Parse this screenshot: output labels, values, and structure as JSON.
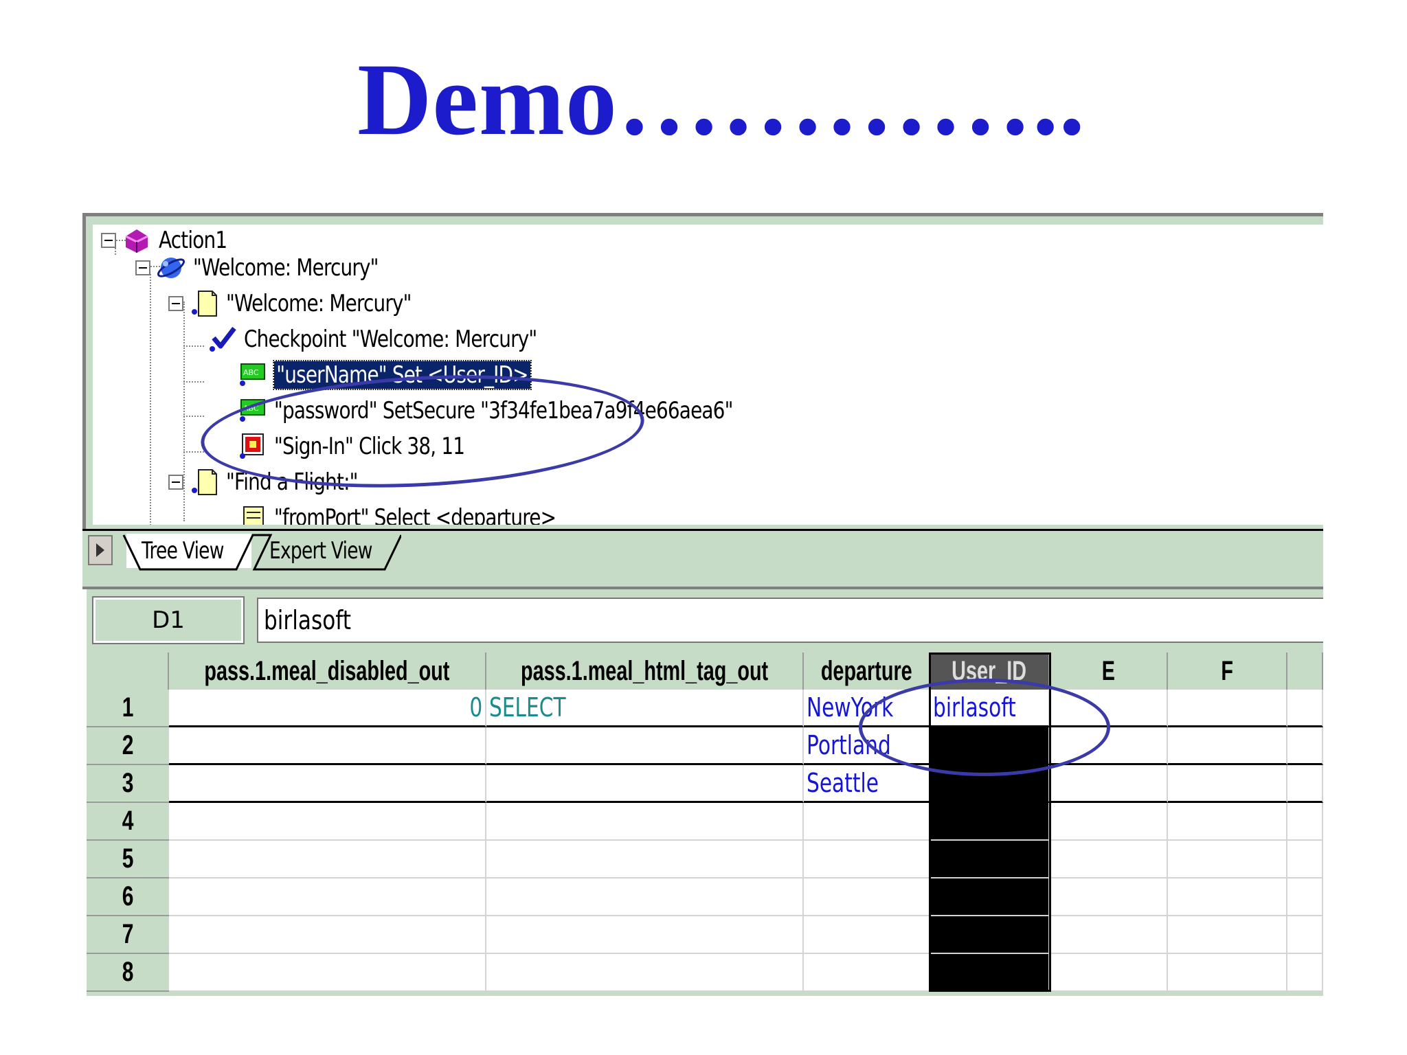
{
  "title": "Demo…………..",
  "tree": {
    "nodes": [
      {
        "label": "Action1"
      },
      {
        "label": "\"Welcome: Mercury\""
      },
      {
        "label": "\"Welcome: Mercury\""
      },
      {
        "label": "Checkpoint \"Welcome: Mercury\""
      },
      {
        "label": "\"userName\" Set <User_ID>"
      },
      {
        "label": "\"password\" SetSecure \"3f34fe1bea7a9f4e66aea6\""
      },
      {
        "label": "\"Sign-In\" Click 38, 11"
      },
      {
        "label": "\"Find a Flight:\""
      },
      {
        "label": "\"fromPort\" Select <departure>"
      }
    ],
    "icon_text": "ABC"
  },
  "tabs": [
    {
      "label": "Tree View"
    },
    {
      "label": "Expert View"
    }
  ],
  "data_table": {
    "cell_ref": "D1",
    "formula_value": "birlasoft",
    "columns": [
      "pass.1.meal_disabled_out",
      "pass.1.meal_html_tag_out",
      "departure",
      "User_ID",
      "E",
      "F"
    ],
    "row_numbers": [
      "1",
      "2",
      "3",
      "4",
      "5",
      "6",
      "7",
      "8"
    ],
    "rows": [
      [
        "0",
        "SELECT",
        "NewYork",
        "birlasoft",
        "",
        ""
      ],
      [
        "",
        "",
        "Portland",
        "",
        "",
        ""
      ],
      [
        "",
        "",
        "Seattle",
        "",
        "",
        ""
      ],
      [
        "",
        "",
        "",
        "",
        "",
        ""
      ],
      [
        "",
        "",
        "",
        "",
        "",
        ""
      ],
      [
        "",
        "",
        "",
        "",
        "",
        ""
      ],
      [
        "",
        "",
        "",
        "",
        "",
        ""
      ],
      [
        "",
        "",
        "",
        "",
        "",
        ""
      ]
    ]
  },
  "colors": {
    "title": "#1c1ccc",
    "panel": "#c6dcc6",
    "annotation": "#3a3aa8",
    "selection": "#0a246a"
  }
}
